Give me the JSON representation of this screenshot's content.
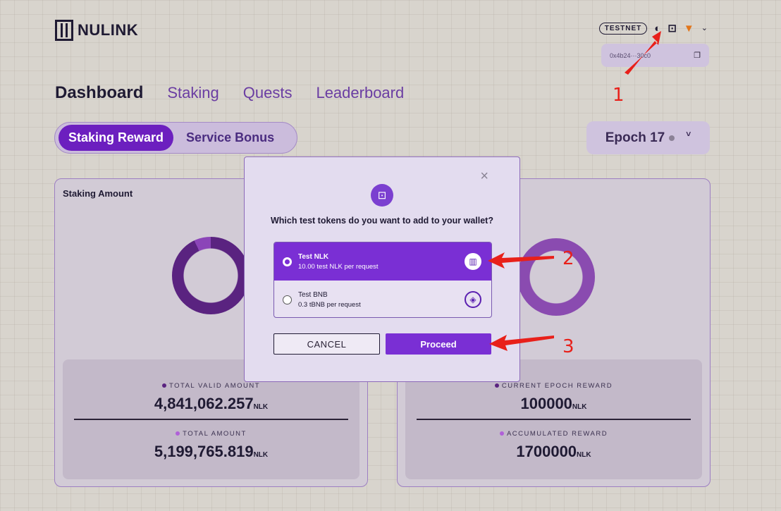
{
  "header": {
    "logo_text": "NULINK",
    "network_badge": "TESTNET",
    "theme_icon": "moon-icon",
    "faucet_icon": "add-token-icon",
    "wallet_icon": "metamask-fox-icon",
    "wallet_address": "0x4b24···30c0"
  },
  "nav": {
    "items": [
      "Dashboard",
      "Staking",
      "Quests",
      "Leaderboard"
    ],
    "active": "Dashboard"
  },
  "tabs": {
    "active": "Staking Reward",
    "inactive": "Service Bonus"
  },
  "epoch": {
    "label": "Epoch 17",
    "chevron": "˅"
  },
  "left_card": {
    "title": "Staking Amount",
    "stat1_label": "TOTAL VALID AMOUNT",
    "stat1_value": "4,841,062.257",
    "stat1_unit": "NLK",
    "stat2_label": "TOTAL AMOUNT",
    "stat2_value": "5,199,765.819",
    "stat2_unit": "NLK"
  },
  "right_card": {
    "stat1_label": "CURRENT EPOCH REWARD",
    "stat1_value": "100000",
    "stat1_unit": "NLK",
    "stat2_label": "ACCUMULATED REWARD",
    "stat2_value": "1700000",
    "stat2_unit": "NLK"
  },
  "modal": {
    "close": "×",
    "question": "Which test tokens do you want to add to your wallet?",
    "options": [
      {
        "name": "Test NLK",
        "desc": "10.00 test NLK per request",
        "selected": true
      },
      {
        "name": "Test BNB",
        "desc": "0.3 tBNB per request",
        "selected": false
      }
    ],
    "cancel_label": "CANCEL",
    "proceed_label": "Proceed"
  },
  "annotations": [
    "1",
    "2",
    "3"
  ],
  "colors": {
    "accent": "#7a2fd4",
    "annotation": "#e8201a"
  }
}
